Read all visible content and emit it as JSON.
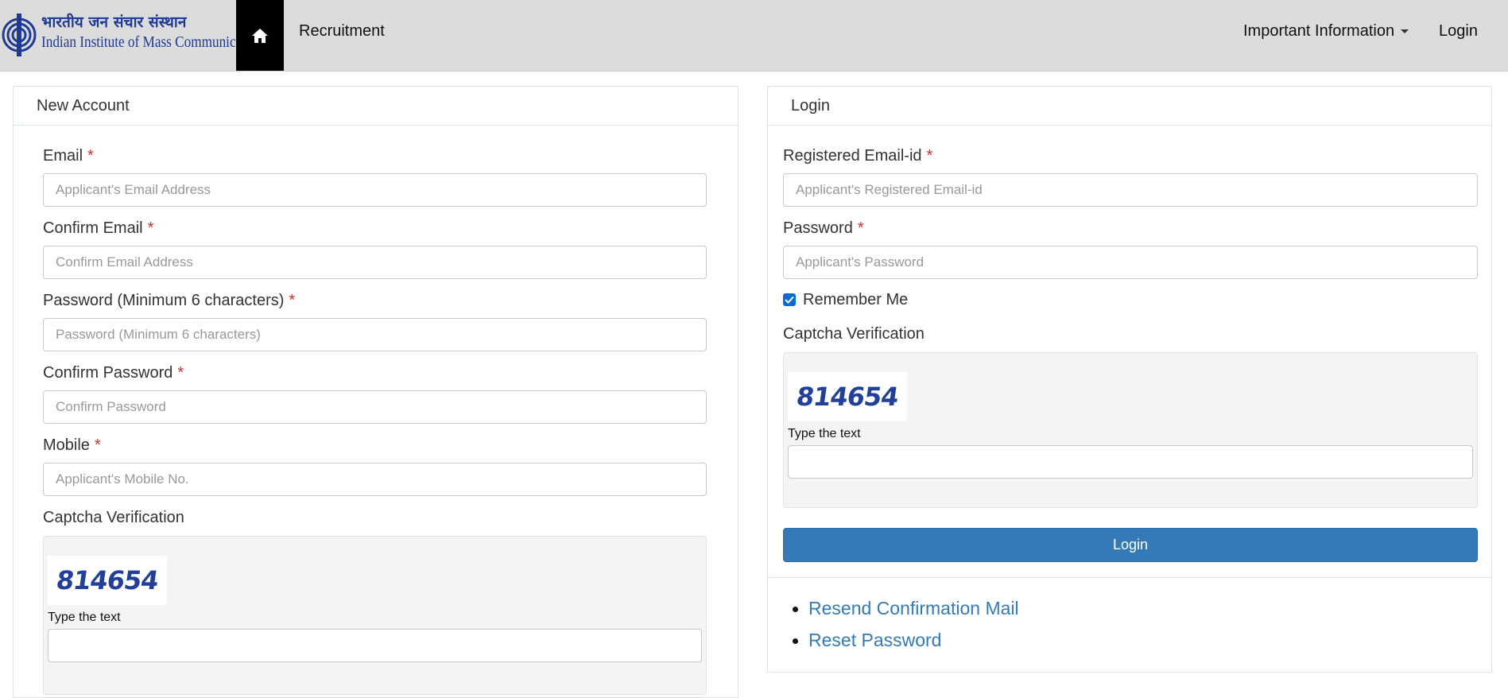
{
  "brand": {
    "hindi_name": "भारतीय जन संचार संस्थान",
    "english_name": "Indian Institute of Mass Communication"
  },
  "nav": {
    "home_icon": "home-icon",
    "recruitment": "Recruitment",
    "important_info": "Important Information",
    "login": "Login"
  },
  "new_account": {
    "title": "New Account",
    "email_label": "Email",
    "email_placeholder": "Applicant's Email Address",
    "confirm_email_label": "Confirm Email",
    "confirm_email_placeholder": "Confirm Email Address",
    "password_label": "Password (Minimum 6 characters)",
    "password_placeholder": "Password (Minimum 6 characters)",
    "confirm_password_label": "Confirm Password",
    "confirm_password_placeholder": "Confirm Password",
    "mobile_label": "Mobile",
    "mobile_placeholder": "Applicant's Mobile No.",
    "captcha_label": "Captcha Verification",
    "captcha_code": "814654",
    "captcha_hint": "Type the text"
  },
  "login_panel": {
    "title": "Login",
    "email_label": "Registered Email-id",
    "email_placeholder": "Applicant's Registered Email-id",
    "password_label": "Password",
    "password_placeholder": "Applicant's Password",
    "remember_label": "Remember Me",
    "remember_checked": true,
    "captcha_label": "Captcha Verification",
    "captcha_code": "814654",
    "captcha_hint": "Type the text",
    "login_button": "Login",
    "links": [
      "Resend Confirmation Mail",
      "Reset Password"
    ]
  },
  "required_marker": "*",
  "colors": {
    "navbar_bg": "#dcdcdc",
    "primary": "#337ab7",
    "required": "#c9302c",
    "brand_blue": "#1f3a93"
  }
}
